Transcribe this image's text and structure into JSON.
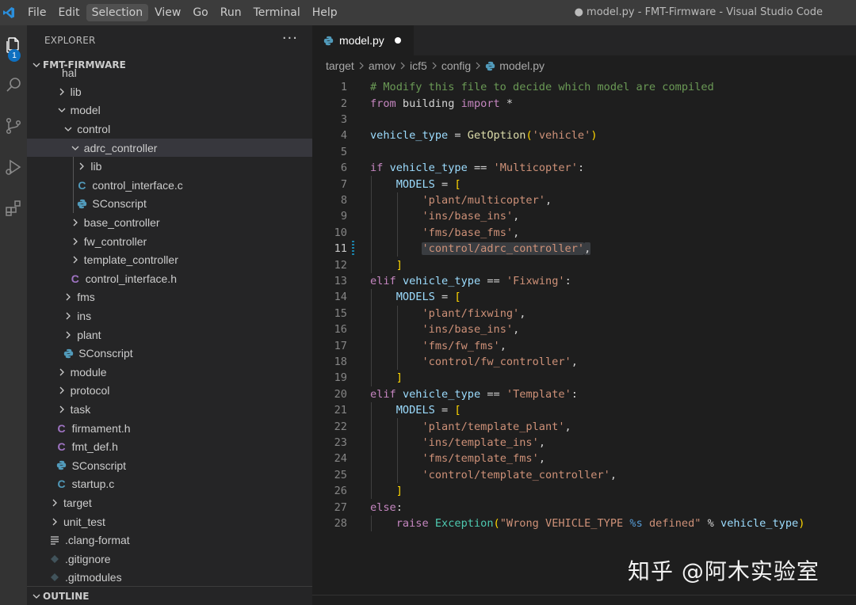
{
  "titlebar": {
    "menu": [
      "File",
      "Edit",
      "Selection",
      "View",
      "Go",
      "Run",
      "Terminal",
      "Help"
    ],
    "active_menu": "Selection",
    "window_title": "● model.py - FMT-Firmware - Visual Studio Code"
  },
  "activity": {
    "items": [
      "files-icon",
      "search-icon",
      "source-control-icon",
      "run-debug-icon",
      "extensions-icon"
    ],
    "explorer_badge": "1"
  },
  "sidebar": {
    "title": "EXPLORER",
    "more": "···",
    "section": "FMT-FIRMWARE",
    "partial_top": "hal",
    "tree": [
      {
        "label": "lib",
        "type": "folder",
        "open": false,
        "depth": 1
      },
      {
        "label": "model",
        "type": "folder",
        "open": true,
        "depth": 1
      },
      {
        "label": "control",
        "type": "folder",
        "open": true,
        "depth": 2
      },
      {
        "label": "adrc_controller",
        "type": "folder",
        "open": true,
        "depth": 3,
        "selected": true
      },
      {
        "label": "lib",
        "type": "folder",
        "open": false,
        "depth": 4
      },
      {
        "label": "control_interface.c",
        "type": "c",
        "depth": 4
      },
      {
        "label": "SConscript",
        "type": "py",
        "depth": 4
      },
      {
        "label": "base_controller",
        "type": "folder",
        "open": false,
        "depth": 3
      },
      {
        "label": "fw_controller",
        "type": "folder",
        "open": false,
        "depth": 3
      },
      {
        "label": "template_controller",
        "type": "folder",
        "open": false,
        "depth": 3
      },
      {
        "label": "control_interface.h",
        "type": "h",
        "depth": 3
      },
      {
        "label": "fms",
        "type": "folder",
        "open": false,
        "depth": 2
      },
      {
        "label": "ins",
        "type": "folder",
        "open": false,
        "depth": 2
      },
      {
        "label": "plant",
        "type": "folder",
        "open": false,
        "depth": 2
      },
      {
        "label": "SConscript",
        "type": "py",
        "depth": 2
      },
      {
        "label": "module",
        "type": "folder",
        "open": false,
        "depth": 1
      },
      {
        "label": "protocol",
        "type": "folder",
        "open": false,
        "depth": 1
      },
      {
        "label": "task",
        "type": "folder",
        "open": false,
        "depth": 1
      },
      {
        "label": "firmament.h",
        "type": "h",
        "depth": 1
      },
      {
        "label": "fmt_def.h",
        "type": "h",
        "depth": 1
      },
      {
        "label": "SConscript",
        "type": "py",
        "depth": 1
      },
      {
        "label": "startup.c",
        "type": "c",
        "depth": 1
      },
      {
        "label": "target",
        "type": "folder",
        "open": false,
        "depth": 0
      },
      {
        "label": "unit_test",
        "type": "folder",
        "open": false,
        "depth": 0
      },
      {
        "label": ".clang-format",
        "type": "lines",
        "depth": 0
      },
      {
        "label": ".gitignore",
        "type": "git",
        "depth": 0
      },
      {
        "label": ".gitmodules",
        "type": "git",
        "depth": 0
      }
    ],
    "outline": "OUTLINE"
  },
  "editor": {
    "tab_label": "model.py",
    "breadcrumb": [
      "target",
      "amov",
      "icf5",
      "config",
      "model.py"
    ],
    "current_line": 11,
    "lines": [
      [
        [
          "cm",
          "# Modify this file to decide which model are compiled"
        ]
      ],
      [
        [
          "k",
          "from"
        ],
        [
          "txt",
          " building "
        ],
        [
          "k",
          "import"
        ],
        [
          "txt",
          " *"
        ]
      ],
      [],
      [
        [
          "var",
          "vehicle_type"
        ],
        [
          "txt",
          " = "
        ],
        [
          "fn",
          "GetOption"
        ],
        [
          "br",
          "("
        ],
        [
          "s",
          "'vehicle'"
        ],
        [
          "br",
          ")"
        ]
      ],
      [],
      [
        [
          "k",
          "if"
        ],
        [
          "txt",
          " "
        ],
        [
          "var",
          "vehicle_type"
        ],
        [
          "txt",
          " == "
        ],
        [
          "s",
          "'Multicopter'"
        ],
        [
          "txt",
          ":"
        ]
      ],
      [
        [
          "txt",
          "    "
        ],
        [
          "var",
          "MODELS"
        ],
        [
          "txt",
          " = "
        ],
        [
          "br",
          "["
        ]
      ],
      [
        [
          "txt",
          "        "
        ],
        [
          "s",
          "'plant/multicopter'"
        ],
        [
          "txt",
          ","
        ]
      ],
      [
        [
          "txt",
          "        "
        ],
        [
          "s",
          "'ins/base_ins'"
        ],
        [
          "txt",
          ","
        ]
      ],
      [
        [
          "txt",
          "        "
        ],
        [
          "s",
          "'fms/base_fms'"
        ],
        [
          "txt",
          ","
        ]
      ],
      [
        [
          "txt",
          "        "
        ],
        [
          "s hl",
          "'control/adrc_controller'"
        ],
        [
          "txt hl",
          ","
        ]
      ],
      [
        [
          "txt",
          "    "
        ],
        [
          "br",
          "]"
        ]
      ],
      [
        [
          "k",
          "elif"
        ],
        [
          "txt",
          " "
        ],
        [
          "var",
          "vehicle_type"
        ],
        [
          "txt",
          " == "
        ],
        [
          "s",
          "'Fixwing'"
        ],
        [
          "txt",
          ":"
        ]
      ],
      [
        [
          "txt",
          "    "
        ],
        [
          "var",
          "MODELS"
        ],
        [
          "txt",
          " = "
        ],
        [
          "br",
          "["
        ]
      ],
      [
        [
          "txt",
          "        "
        ],
        [
          "s",
          "'plant/fixwing'"
        ],
        [
          "txt",
          ","
        ]
      ],
      [
        [
          "txt",
          "        "
        ],
        [
          "s",
          "'ins/base_ins'"
        ],
        [
          "txt",
          ","
        ]
      ],
      [
        [
          "txt",
          "        "
        ],
        [
          "s",
          "'fms/fw_fms'"
        ],
        [
          "txt",
          ","
        ]
      ],
      [
        [
          "txt",
          "        "
        ],
        [
          "s",
          "'control/fw_controller'"
        ],
        [
          "txt",
          ","
        ]
      ],
      [
        [
          "txt",
          "    "
        ],
        [
          "br",
          "]"
        ]
      ],
      [
        [
          "k",
          "elif"
        ],
        [
          "txt",
          " "
        ],
        [
          "var",
          "vehicle_type"
        ],
        [
          "txt",
          " == "
        ],
        [
          "s",
          "'Template'"
        ],
        [
          "txt",
          ":"
        ]
      ],
      [
        [
          "txt",
          "    "
        ],
        [
          "var",
          "MODELS"
        ],
        [
          "txt",
          " = "
        ],
        [
          "br",
          "["
        ]
      ],
      [
        [
          "txt",
          "        "
        ],
        [
          "s",
          "'plant/template_plant'"
        ],
        [
          "txt",
          ","
        ]
      ],
      [
        [
          "txt",
          "        "
        ],
        [
          "s",
          "'ins/template_ins'"
        ],
        [
          "txt",
          ","
        ]
      ],
      [
        [
          "txt",
          "        "
        ],
        [
          "s",
          "'fms/template_fms'"
        ],
        [
          "txt",
          ","
        ]
      ],
      [
        [
          "txt",
          "        "
        ],
        [
          "s",
          "'control/template_controller'"
        ],
        [
          "txt",
          ","
        ]
      ],
      [
        [
          "txt",
          "    "
        ],
        [
          "br",
          "]"
        ]
      ],
      [
        [
          "k",
          "else"
        ],
        [
          "txt",
          ":"
        ]
      ],
      [
        [
          "txt",
          "    "
        ],
        [
          "k",
          "raise"
        ],
        [
          "txt",
          " "
        ],
        [
          "cls",
          "Exception"
        ],
        [
          "br",
          "("
        ],
        [
          "s",
          "\"Wrong VEHICLE_TYPE "
        ],
        [
          "k2",
          "%s"
        ],
        [
          "s",
          " defined\""
        ],
        [
          "txt",
          " % "
        ],
        [
          "var",
          "vehicle_type"
        ],
        [
          "br",
          ")"
        ]
      ]
    ]
  },
  "watermark": "知乎 @阿木实验室",
  "colors": {
    "accent": "#0e70c0",
    "selection": "#37373d",
    "string": "#ce9178",
    "keyword": "#c586c0"
  }
}
